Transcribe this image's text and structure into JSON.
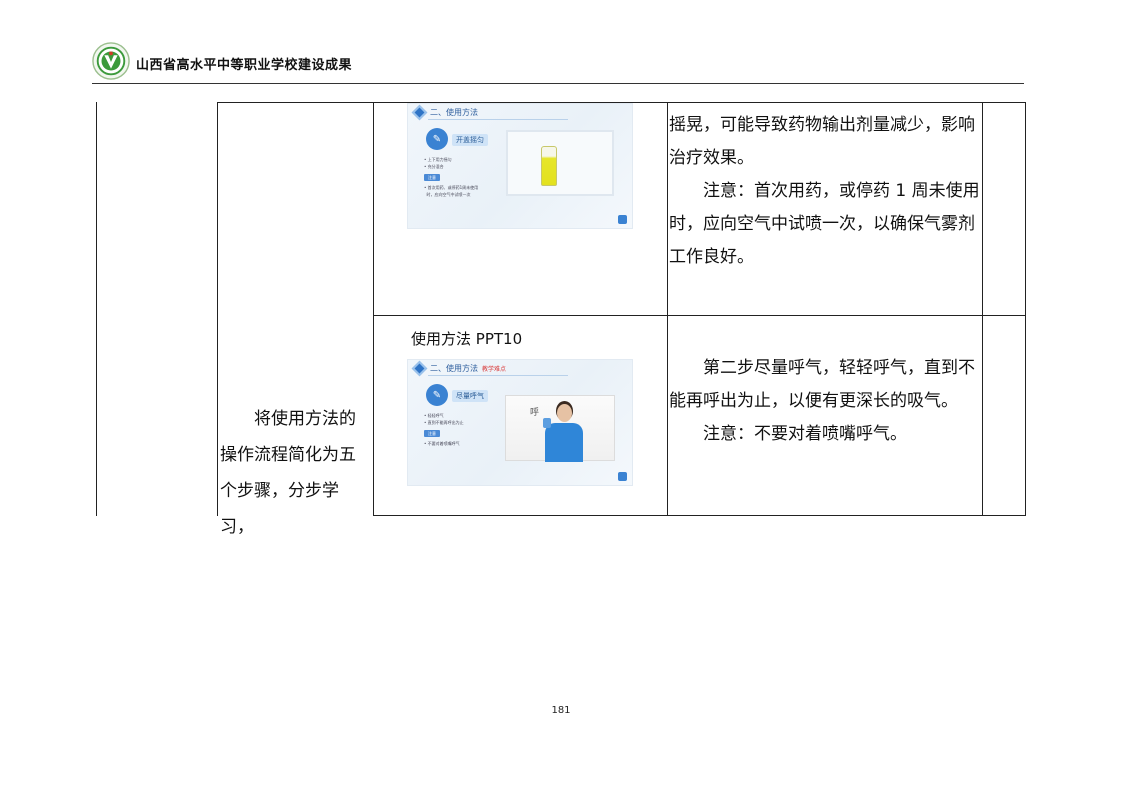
{
  "header": {
    "title": "山西省高水平中等职业学校建设成果"
  },
  "table": {
    "left_text": "将使用方法的操作流程简化为五个步骤，分步学习，",
    "row1": {
      "slide": {
        "title": "二、使用方法",
        "step": "开盖摇匀",
        "bullets": [
          "上下用力摇匀",
          "充分混合"
        ],
        "note_label": "注意",
        "note_lines": [
          "首次用药、或停药1周未使用",
          "时，应向空气中试喷一次"
        ]
      },
      "paragraph1": "摇晃，可能导致药物输出剂量减少，影响治疗效果。",
      "paragraph2": "注意：首次用药，或停药 1 周未使用时，应向空气中试喷一次，以确保气雾剂工作良好。"
    },
    "row2": {
      "caption": "使用方法 PPT10",
      "slide": {
        "title": "二、使用方法",
        "tag": "教学难点",
        "step": "尽量呼气",
        "bullets": [
          "轻轻呼气",
          "直到不能再呼出为止"
        ],
        "note_label": "注意",
        "note_lines": [
          "不要对着喷嘴呼气"
        ],
        "photo_label": "呼"
      },
      "paragraph1": "第二步尽量呼气，轻轻呼气，直到不能再呼出为止，以便有更深长的吸气。",
      "paragraph2": "注意：不要对着喷嘴呼气。"
    }
  },
  "footer": {
    "page_number": "181"
  },
  "colors": {
    "accent": "#2f74c6",
    "logo_green": "#3c9a3c",
    "logo_red": "#d23a2a"
  },
  "icons": {
    "logo": "school-emblem-icon",
    "slide_step": "edit-icon",
    "slide_nav": "next-page-icon"
  }
}
